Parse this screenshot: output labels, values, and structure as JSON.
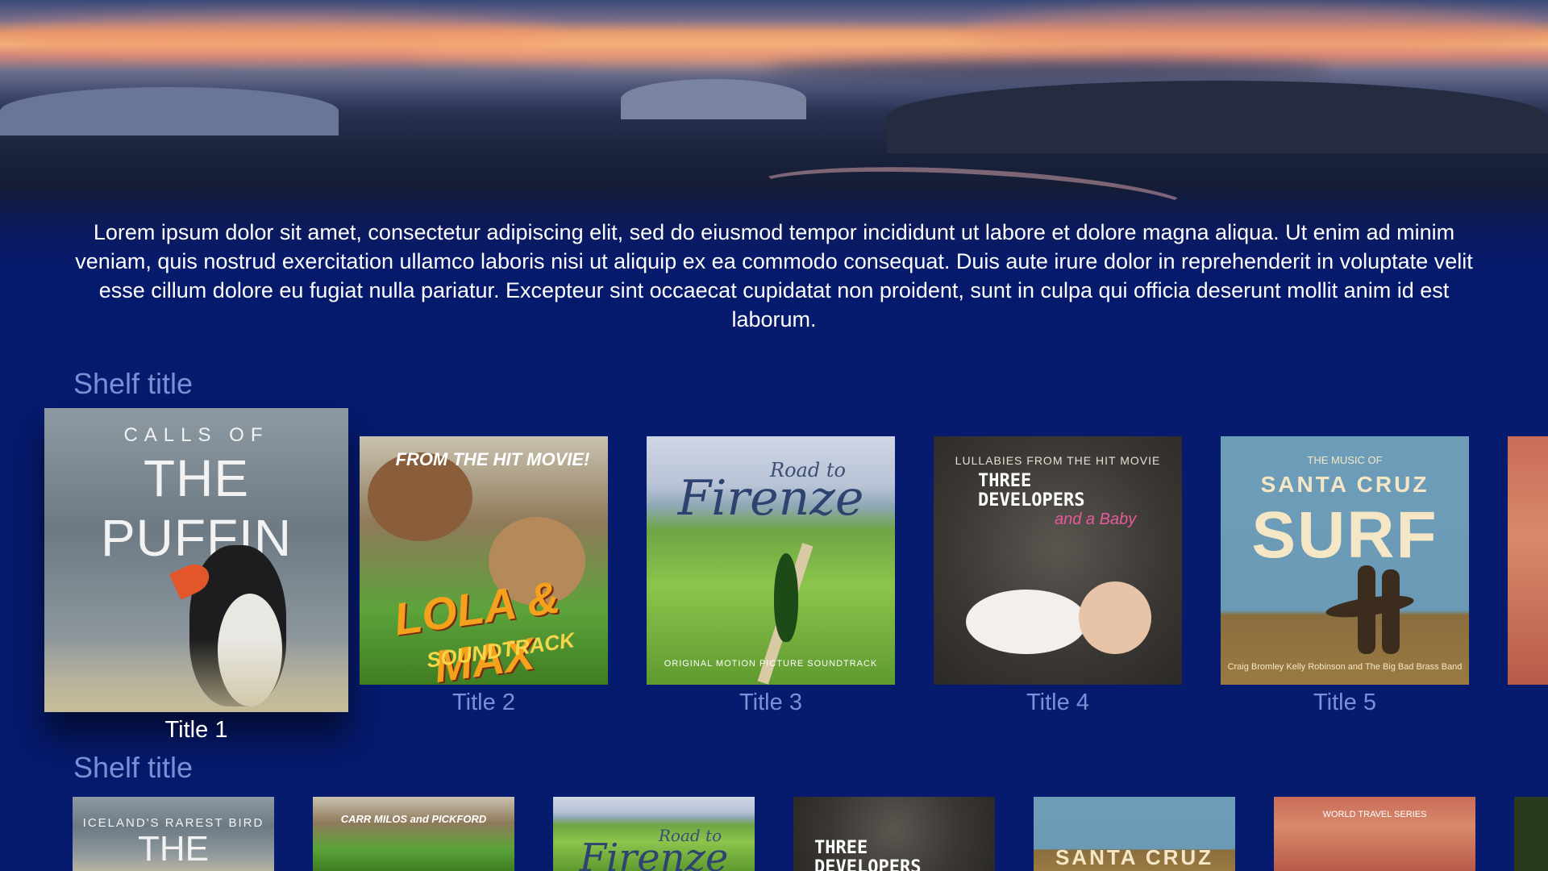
{
  "description": "Lorem ipsum dolor sit amet, consectetur adipiscing elit, sed do eiusmod tempor incididunt ut labore et dolore magna aliqua. Ut enim ad minim veniam, quis nostrud exercitation ullamco laboris nisi ut aliquip ex ea commodo consequat. Duis aute irure dolor in reprehenderit in voluptate velit esse cillum dolore eu fugiat nulla pariatur. Excepteur sint occaecat cupidatat non proident, sunt in culpa qui officia deserunt mollit anim id est laborum.",
  "shelf1": {
    "title": "Shelf title",
    "items": [
      {
        "caption": "Title 1",
        "cover_top": "CALLS OF",
        "cover_main": "THE PUFFIN"
      },
      {
        "caption": "Title 2",
        "cover_top": "FROM THE HIT MOVIE!",
        "cover_main": "LOLA & MAX",
        "cover_sub": "SOUNDTRACK"
      },
      {
        "caption": "Title 3",
        "cover_top": "Road to",
        "cover_main": "Firenze",
        "cover_sub": "ORIGINAL MOTION PICTURE SOUNDTRACK"
      },
      {
        "caption": "Title 4",
        "cover_top": "LULLABIES FROM THE HIT MOVIE",
        "cover_main": "THREE DEVELOPERS",
        "cover_sub": "and a Baby"
      },
      {
        "caption": "Title 5",
        "cover_top": "THE MUSIC OF",
        "cover_main": "SANTA CRUZ",
        "cover_big": "SURF",
        "cover_credits": "Craig Bromley     Kelly Robinson     and The Big Bad Brass Band"
      }
    ]
  },
  "shelf2": {
    "title": "Shelf title",
    "items": [
      {
        "cover_top": "ICELAND'S RAREST BIRD",
        "cover_main": "THE PUFFIN"
      },
      {
        "cover_top": "CARR     MILOS     and PICKFORD"
      },
      {
        "cover_top": "Road to",
        "cover_main": "Firenze"
      },
      {
        "cover_main": "THREE DEVELOPERS"
      },
      {
        "cover_main": "SANTA CRUZ"
      },
      {
        "cover_top": "WORLD TRAVEL SERIES"
      }
    ]
  }
}
